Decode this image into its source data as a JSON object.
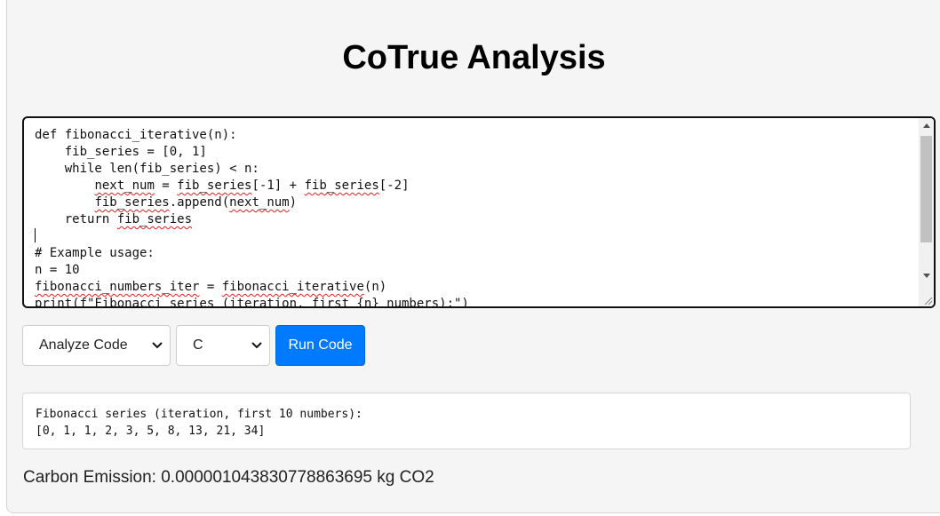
{
  "app": {
    "title": "CoTrue Analysis"
  },
  "editor": {
    "lines": [
      "def fibonacci_iterative(n):",
      "    fib_series = [0, 1]",
      "    while len(fib_series) < n:",
      "        next_num = fib_series[-1] + fib_series[-2]",
      "        fib_series.append(next_num)",
      "    return fib_series",
      "",
      "# Example usage:",
      "n = 10",
      "fibonacci_numbers_iter = fibonacci_iterative(n)",
      "print(f\"Fibonacci series (iteration, first {n} numbers):\")"
    ],
    "code_text": "def fibonacci_iterative(n):\n    fib_series = [0, 1]\n    while len(fib_series) < n:\n        next_num = fib_series[-1] + fib_series[-2]\n        fib_series.append(next_num)\n    return fib_series\n\n# Example usage:\nn = 10\nfibonacci_numbers_iter = fibonacci_iterative(n)\nprint(f\"Fibonacci series (iteration, first {n} numbers):\")"
  },
  "controls": {
    "mode_select": {
      "selected": "Analyze Code"
    },
    "language_select": {
      "selected": "C"
    },
    "run_button_label": "Run Code"
  },
  "output": {
    "line1": "Fibonacci series (iteration, first 10 numbers):",
    "line2": "[0, 1, 1, 2, 3, 5, 8, 13, 21, 34]"
  },
  "footer": {
    "carbon_text": "Carbon Emission: 0.000001043830778863695 kg CO2"
  },
  "colors": {
    "accent": "#007bff",
    "spellcheck": "#e02020"
  },
  "icons": {
    "select_arrow": "chevron-down-icon",
    "scroll_up": "scroll-up-arrow-icon",
    "scroll_down": "scroll-down-arrow-icon",
    "resize": "resize-grip-icon"
  }
}
